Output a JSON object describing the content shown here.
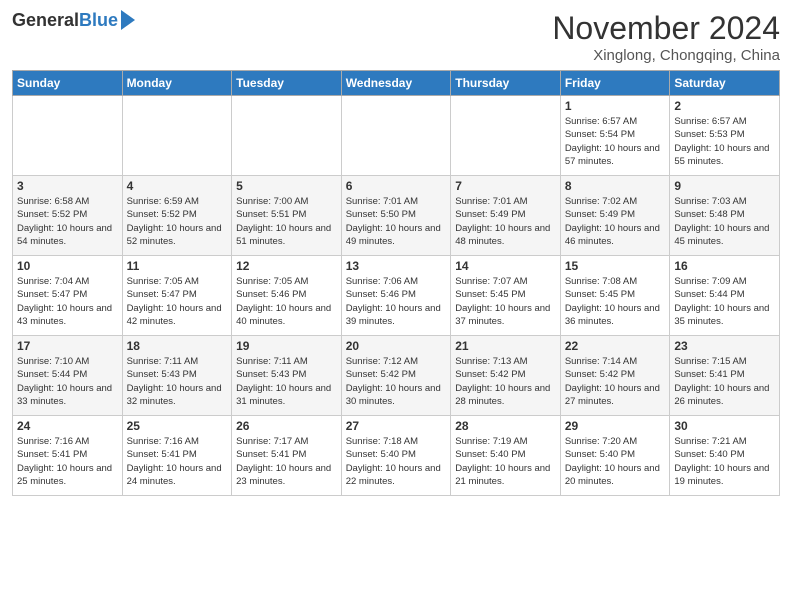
{
  "header": {
    "logo_general": "General",
    "logo_blue": "Blue",
    "month_title": "November 2024",
    "location": "Xinglong, Chongqing, China"
  },
  "days_of_week": [
    "Sunday",
    "Monday",
    "Tuesday",
    "Wednesday",
    "Thursday",
    "Friday",
    "Saturday"
  ],
  "weeks": [
    [
      {
        "day": "",
        "info": ""
      },
      {
        "day": "",
        "info": ""
      },
      {
        "day": "",
        "info": ""
      },
      {
        "day": "",
        "info": ""
      },
      {
        "day": "",
        "info": ""
      },
      {
        "day": "1",
        "info": "Sunrise: 6:57 AM\nSunset: 5:54 PM\nDaylight: 10 hours and 57 minutes."
      },
      {
        "day": "2",
        "info": "Sunrise: 6:57 AM\nSunset: 5:53 PM\nDaylight: 10 hours and 55 minutes."
      }
    ],
    [
      {
        "day": "3",
        "info": "Sunrise: 6:58 AM\nSunset: 5:52 PM\nDaylight: 10 hours and 54 minutes."
      },
      {
        "day": "4",
        "info": "Sunrise: 6:59 AM\nSunset: 5:52 PM\nDaylight: 10 hours and 52 minutes."
      },
      {
        "day": "5",
        "info": "Sunrise: 7:00 AM\nSunset: 5:51 PM\nDaylight: 10 hours and 51 minutes."
      },
      {
        "day": "6",
        "info": "Sunrise: 7:01 AM\nSunset: 5:50 PM\nDaylight: 10 hours and 49 minutes."
      },
      {
        "day": "7",
        "info": "Sunrise: 7:01 AM\nSunset: 5:49 PM\nDaylight: 10 hours and 48 minutes."
      },
      {
        "day": "8",
        "info": "Sunrise: 7:02 AM\nSunset: 5:49 PM\nDaylight: 10 hours and 46 minutes."
      },
      {
        "day": "9",
        "info": "Sunrise: 7:03 AM\nSunset: 5:48 PM\nDaylight: 10 hours and 45 minutes."
      }
    ],
    [
      {
        "day": "10",
        "info": "Sunrise: 7:04 AM\nSunset: 5:47 PM\nDaylight: 10 hours and 43 minutes."
      },
      {
        "day": "11",
        "info": "Sunrise: 7:05 AM\nSunset: 5:47 PM\nDaylight: 10 hours and 42 minutes."
      },
      {
        "day": "12",
        "info": "Sunrise: 7:05 AM\nSunset: 5:46 PM\nDaylight: 10 hours and 40 minutes."
      },
      {
        "day": "13",
        "info": "Sunrise: 7:06 AM\nSunset: 5:46 PM\nDaylight: 10 hours and 39 minutes."
      },
      {
        "day": "14",
        "info": "Sunrise: 7:07 AM\nSunset: 5:45 PM\nDaylight: 10 hours and 37 minutes."
      },
      {
        "day": "15",
        "info": "Sunrise: 7:08 AM\nSunset: 5:45 PM\nDaylight: 10 hours and 36 minutes."
      },
      {
        "day": "16",
        "info": "Sunrise: 7:09 AM\nSunset: 5:44 PM\nDaylight: 10 hours and 35 minutes."
      }
    ],
    [
      {
        "day": "17",
        "info": "Sunrise: 7:10 AM\nSunset: 5:44 PM\nDaylight: 10 hours and 33 minutes."
      },
      {
        "day": "18",
        "info": "Sunrise: 7:11 AM\nSunset: 5:43 PM\nDaylight: 10 hours and 32 minutes."
      },
      {
        "day": "19",
        "info": "Sunrise: 7:11 AM\nSunset: 5:43 PM\nDaylight: 10 hours and 31 minutes."
      },
      {
        "day": "20",
        "info": "Sunrise: 7:12 AM\nSunset: 5:42 PM\nDaylight: 10 hours and 30 minutes."
      },
      {
        "day": "21",
        "info": "Sunrise: 7:13 AM\nSunset: 5:42 PM\nDaylight: 10 hours and 28 minutes."
      },
      {
        "day": "22",
        "info": "Sunrise: 7:14 AM\nSunset: 5:42 PM\nDaylight: 10 hours and 27 minutes."
      },
      {
        "day": "23",
        "info": "Sunrise: 7:15 AM\nSunset: 5:41 PM\nDaylight: 10 hours and 26 minutes."
      }
    ],
    [
      {
        "day": "24",
        "info": "Sunrise: 7:16 AM\nSunset: 5:41 PM\nDaylight: 10 hours and 25 minutes."
      },
      {
        "day": "25",
        "info": "Sunrise: 7:16 AM\nSunset: 5:41 PM\nDaylight: 10 hours and 24 minutes."
      },
      {
        "day": "26",
        "info": "Sunrise: 7:17 AM\nSunset: 5:41 PM\nDaylight: 10 hours and 23 minutes."
      },
      {
        "day": "27",
        "info": "Sunrise: 7:18 AM\nSunset: 5:40 PM\nDaylight: 10 hours and 22 minutes."
      },
      {
        "day": "28",
        "info": "Sunrise: 7:19 AM\nSunset: 5:40 PM\nDaylight: 10 hours and 21 minutes."
      },
      {
        "day": "29",
        "info": "Sunrise: 7:20 AM\nSunset: 5:40 PM\nDaylight: 10 hours and 20 minutes."
      },
      {
        "day": "30",
        "info": "Sunrise: 7:21 AM\nSunset: 5:40 PM\nDaylight: 10 hours and 19 minutes."
      }
    ]
  ]
}
